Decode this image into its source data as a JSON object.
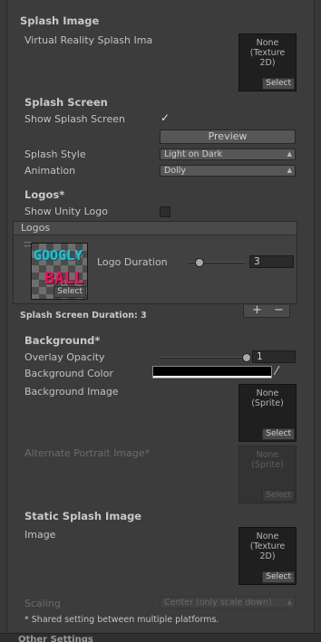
{
  "splash_image": {
    "header": "Splash Image",
    "vr_label": "Virtual Reality Splash Ima",
    "vr_thumb": {
      "line1": "None",
      "line2": "(Texture",
      "line3": "2D)",
      "select": "Select"
    }
  },
  "splash_screen": {
    "header": "Splash Screen",
    "show_label": "Show Splash Screen",
    "show_checked": "✓",
    "preview_button": "Preview",
    "style_label": "Splash Style",
    "style_value": "Light on Dark",
    "animation_label": "Animation",
    "animation_value": "Dolly"
  },
  "logos": {
    "header": "Logos*",
    "show_unity_label": "Show Unity Logo",
    "list_header": "Logos",
    "item": {
      "image_text1": "GOOGLY",
      "image_text2": "BALL",
      "select": "Select",
      "duration_label": "Logo Duration",
      "duration_value": "3",
      "duration_fraction": 0.2
    },
    "add_button": "+",
    "remove_button": "−",
    "total_duration": "Splash Screen Duration: 3"
  },
  "background": {
    "header": "Background*",
    "overlay_label": "Overlay Opacity",
    "overlay_value": "1",
    "overlay_fraction": 1.0,
    "color_label": "Background Color",
    "color_value": "#000000",
    "image_label": "Background Image",
    "image_thumb": {
      "line1": "None",
      "line2": "(Sprite)",
      "select": "Select"
    },
    "alt_label": "Alternate Portrait Image*",
    "alt_thumb": {
      "line1": "None",
      "line2": "(Sprite)",
      "select": "Select"
    }
  },
  "static_splash": {
    "header": "Static Splash Image",
    "image_label": "Image",
    "image_thumb": {
      "line1": "None",
      "line2": "(Texture",
      "line3": "2D)",
      "select": "Select"
    },
    "scaling_label": "Scaling",
    "scaling_value": "Center (only scale down)",
    "footnote": "* Shared setting between multiple platforms."
  },
  "next_section": "Other Settings",
  "icons": {
    "dropdown": "chevron-updown-icon",
    "drag": "drag-handle-icon",
    "picker": "eyedropper-icon"
  }
}
